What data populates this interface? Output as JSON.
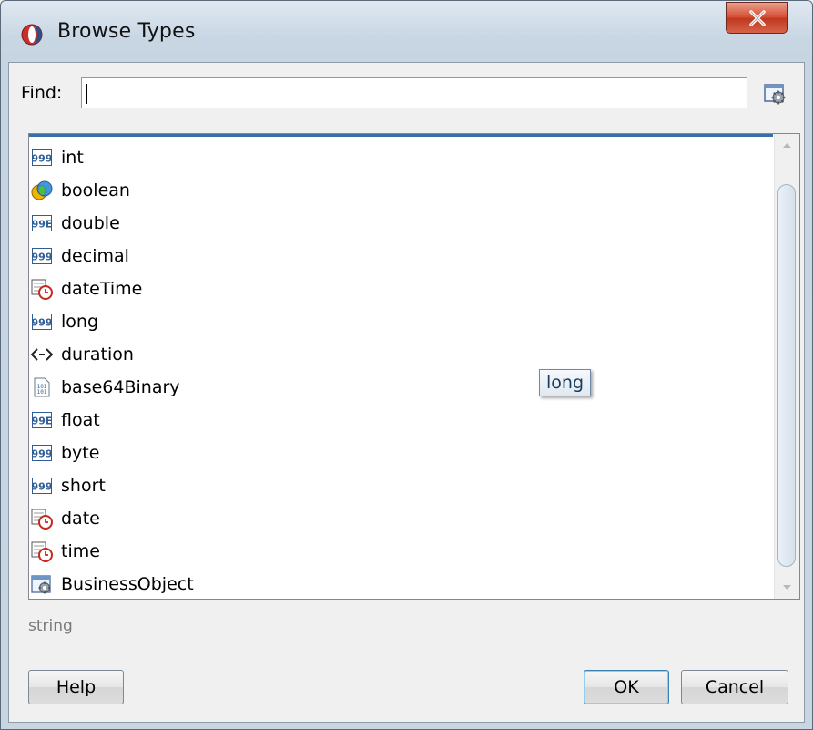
{
  "window": {
    "title": "Browse Types",
    "close_icon": "close-x-icon"
  },
  "find": {
    "label": "Find:",
    "value": "",
    "placeholder": ""
  },
  "settings_icon": "settings-gear-icon",
  "types": [
    {
      "label": "int",
      "icon": "numeric-999-icon"
    },
    {
      "label": "boolean",
      "icon": "boolean-circles-icon"
    },
    {
      "label": "double",
      "icon": "float-99E-icon"
    },
    {
      "label": "decimal",
      "icon": "numeric-999-icon"
    },
    {
      "label": "dateTime",
      "icon": "calendar-clock-icon"
    },
    {
      "label": "long",
      "icon": "numeric-999-icon"
    },
    {
      "label": "duration",
      "icon": "duration-arrows-icon"
    },
    {
      "label": "base64Binary",
      "icon": "binary-file-icon"
    },
    {
      "label": "float",
      "icon": "float-99E-icon"
    },
    {
      "label": "byte",
      "icon": "numeric-999-icon"
    },
    {
      "label": "short",
      "icon": "numeric-999-icon"
    },
    {
      "label": "date",
      "icon": "calendar-clock-icon"
    },
    {
      "label": "time",
      "icon": "calendar-clock-icon"
    },
    {
      "label": "BusinessObject",
      "icon": "business-object-icon"
    }
  ],
  "tooltip": "long",
  "status": "string",
  "buttons": {
    "help": "Help",
    "ok": "OK",
    "cancel": "Cancel"
  },
  "colors": {
    "accent": "#3b6ea5",
    "close_red": "#c0361f"
  }
}
